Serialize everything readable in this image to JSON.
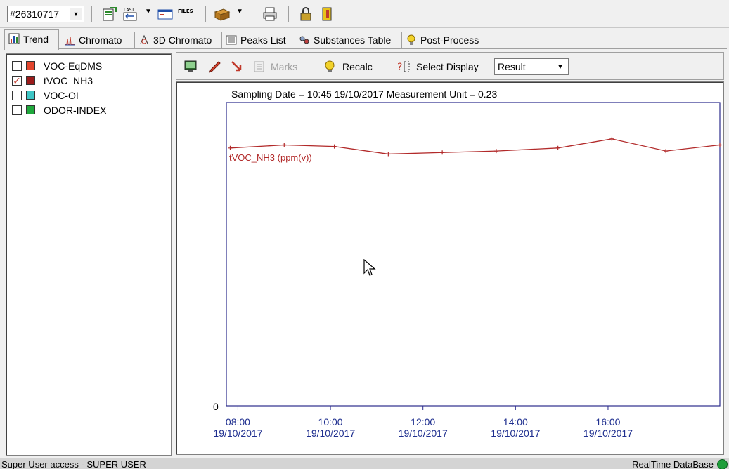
{
  "toolbar": {
    "record_selector": "#26310717",
    "last_label": "LAST",
    "files_filter_label": "FILES FILTER",
    "icons": [
      "export-icon",
      "last-record-icon",
      "files-filter-icon",
      "database-icon",
      "print-icon",
      "lock-icon",
      "exit-icon"
    ]
  },
  "tabs": [
    {
      "label": "Trend",
      "icon": "trend-icon",
      "active": true
    },
    {
      "label": "Chromato",
      "icon": "chromato-icon",
      "active": false
    },
    {
      "label": "3D Chromato",
      "icon": "3d-chromato-icon",
      "active": false
    },
    {
      "label": "Peaks List",
      "icon": "peaks-list-icon",
      "active": false
    },
    {
      "label": "Substances Table",
      "icon": "substances-table-icon",
      "active": false
    },
    {
      "label": "Post-Process",
      "icon": "post-process-icon",
      "active": false
    }
  ],
  "series_list": [
    {
      "label": "VOC-EqDMS",
      "color": "#e2452d",
      "checked": false
    },
    {
      "label": "tVOC_NH3",
      "color": "#9b1b1b",
      "checked": true
    },
    {
      "label": "VOC-OI",
      "color": "#3ec6c6",
      "checked": false
    },
    {
      "label": "ODOR-INDEX",
      "color": "#1fa83c",
      "checked": false
    }
  ],
  "chart_toolbar": {
    "marks_label": "Marks",
    "recalc_label": "Recalc",
    "select_display_label": "Select Display",
    "display_value": "Result",
    "icons": [
      "monitor-icon",
      "pen-icon",
      "arrow-icon",
      "marks-icon",
      "bulb-icon",
      "select-display-icon"
    ]
  },
  "chart_data": {
    "type": "line",
    "title": "Sampling Date = 10:45 19/10/2017   Measurement Unit = 0.23",
    "xlabel": "",
    "ylabel": "",
    "y_tick_labels": [
      "0"
    ],
    "x_tick_labels": [
      {
        "time": "08:00",
        "date": "19/10/2017"
      },
      {
        "time": "10:00",
        "date": "19/10/2017"
      },
      {
        "time": "12:00",
        "date": "19/10/2017"
      },
      {
        "time": "14:00",
        "date": "19/10/2017"
      },
      {
        "time": "16:00",
        "date": "19/10/2017"
      }
    ],
    "series": [
      {
        "name": "tVOC_NH3 (ppm(v))",
        "color": "#b22a2a",
        "x": [
          "07:50",
          "09:00",
          "10:05",
          "11:15",
          "12:25",
          "13:35",
          "14:55",
          "16:05",
          "17:15",
          "18:25"
        ],
        "values": [
          0.85,
          0.86,
          0.855,
          0.83,
          0.835,
          0.84,
          0.85,
          0.88,
          0.84,
          0.86
        ]
      }
    ],
    "ylim": [
      0,
      1.0
    ],
    "xlim": [
      "07:45",
      "18:25"
    ],
    "grid": false
  },
  "status": {
    "user_text": "Super User access - SUPER USER",
    "db_text": "RealTime DataBase",
    "db_status_color": "#1e9e3a"
  }
}
